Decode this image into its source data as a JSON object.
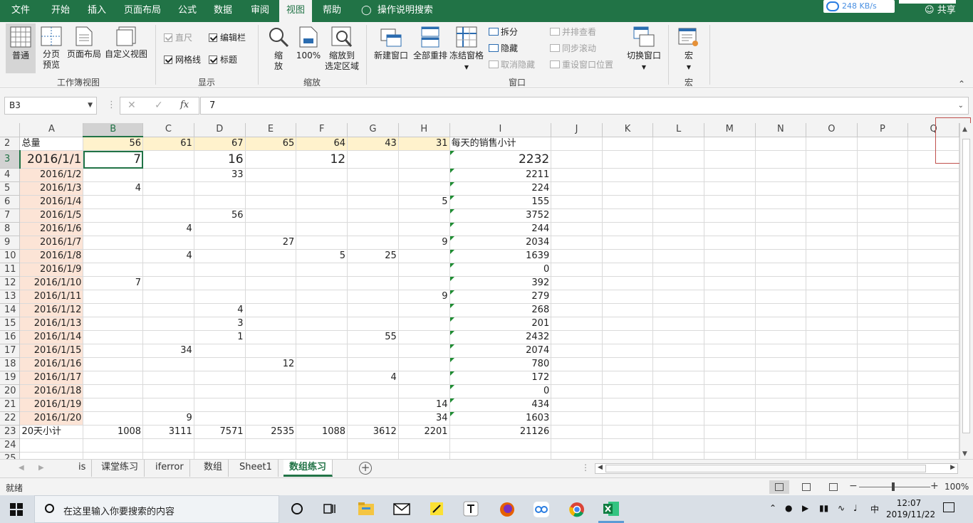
{
  "ribbon_tabs": [
    "文件",
    "开始",
    "插入",
    "页面布局",
    "公式",
    "数据",
    "审阅",
    "视图",
    "帮助",
    "操作说明搜索"
  ],
  "active_tab": "视图",
  "network_speed": "248 KB/s",
  "share_label": "共享",
  "ribbon": {
    "workbook_views": {
      "normal": "普通",
      "page_break_1": "分页",
      "page_break_2": "预览",
      "page_layout": "页面布局",
      "custom": "自定义视图",
      "group": "工作簿视图"
    },
    "show": {
      "ruler": "直尺",
      "formula_bar": "编辑栏",
      "gridlines": "网格线",
      "headings": "标题",
      "group": "显示"
    },
    "zoom": {
      "zoom_1": "缩",
      "zoom_2": "放",
      "hundred": "100%",
      "fit_1": "缩放到",
      "fit_2": "选定区域",
      "group": "缩放"
    },
    "window": {
      "new_window": "新建窗口",
      "arrange_all": "全部重排",
      "freeze": "冻结窗格",
      "split": "拆分",
      "hide": "隐藏",
      "unhide": "取消隐藏",
      "side_by_side": "并排查看",
      "sync_scroll": "同步滚动",
      "reset_pos": "重设窗口位置",
      "switch": "切换窗口",
      "group": "窗口"
    },
    "macros": {
      "macro": "宏",
      "group": "宏"
    }
  },
  "formula_bar": {
    "name_box": "B3",
    "fx": "fx",
    "value": "7"
  },
  "columns": [
    "A",
    "B",
    "C",
    "D",
    "E",
    "F",
    "G",
    "H",
    "I",
    "J",
    "K",
    "L",
    "M",
    "N",
    "O",
    "P",
    "Q"
  ],
  "rows": [
    {
      "n": "2",
      "a": "总量",
      "b": "56",
      "c": "61",
      "d": "67",
      "e": "65",
      "f": "64",
      "g": "43",
      "h": "31",
      "i": "每天的销售小计"
    },
    {
      "n": "3",
      "a": "2016/1/1",
      "b": "7",
      "c": "",
      "d": "16",
      "e": "",
      "f": "12",
      "g": "",
      "h": "",
      "i": "2232"
    },
    {
      "n": "4",
      "a": "2016/1/2",
      "b": "",
      "c": "",
      "d": "33",
      "e": "",
      "f": "",
      "g": "",
      "h": "",
      "i": "2211"
    },
    {
      "n": "5",
      "a": "2016/1/3",
      "b": "4",
      "c": "",
      "d": "",
      "e": "",
      "f": "",
      "g": "",
      "h": "",
      "i": "224"
    },
    {
      "n": "6",
      "a": "2016/1/4",
      "b": "",
      "c": "",
      "d": "",
      "e": "",
      "f": "",
      "g": "",
      "h": "5",
      "i": "155"
    },
    {
      "n": "7",
      "a": "2016/1/5",
      "b": "",
      "c": "",
      "d": "56",
      "e": "",
      "f": "",
      "g": "",
      "h": "",
      "i": "3752"
    },
    {
      "n": "8",
      "a": "2016/1/6",
      "b": "",
      "c": "4",
      "d": "",
      "e": "",
      "f": "",
      "g": "",
      "h": "",
      "i": "244"
    },
    {
      "n": "9",
      "a": "2016/1/7",
      "b": "",
      "c": "",
      "d": "",
      "e": "27",
      "f": "",
      "g": "",
      "h": "9",
      "i": "2034"
    },
    {
      "n": "10",
      "a": "2016/1/8",
      "b": "",
      "c": "4",
      "d": "",
      "e": "",
      "f": "5",
      "g": "25",
      "h": "",
      "i": "1639"
    },
    {
      "n": "11",
      "a": "2016/1/9",
      "b": "",
      "c": "",
      "d": "",
      "e": "",
      "f": "",
      "g": "",
      "h": "",
      "i": "0"
    },
    {
      "n": "12",
      "a": "2016/1/10",
      "b": "7",
      "c": "",
      "d": "",
      "e": "",
      "f": "",
      "g": "",
      "h": "",
      "i": "392"
    },
    {
      "n": "13",
      "a": "2016/1/11",
      "b": "",
      "c": "",
      "d": "",
      "e": "",
      "f": "",
      "g": "",
      "h": "9",
      "i": "279"
    },
    {
      "n": "14",
      "a": "2016/1/12",
      "b": "",
      "c": "",
      "d": "4",
      "e": "",
      "f": "",
      "g": "",
      "h": "",
      "i": "268"
    },
    {
      "n": "15",
      "a": "2016/1/13",
      "b": "",
      "c": "",
      "d": "3",
      "e": "",
      "f": "",
      "g": "",
      "h": "",
      "i": "201"
    },
    {
      "n": "16",
      "a": "2016/1/14",
      "b": "",
      "c": "",
      "d": "1",
      "e": "",
      "f": "",
      "g": "55",
      "h": "",
      "i": "2432"
    },
    {
      "n": "17",
      "a": "2016/1/15",
      "b": "",
      "c": "34",
      "d": "",
      "e": "",
      "f": "",
      "g": "",
      "h": "",
      "i": "2074"
    },
    {
      "n": "18",
      "a": "2016/1/16",
      "b": "",
      "c": "",
      "d": "",
      "e": "12",
      "f": "",
      "g": "",
      "h": "",
      "i": "780"
    },
    {
      "n": "19",
      "a": "2016/1/17",
      "b": "",
      "c": "",
      "d": "",
      "e": "",
      "f": "",
      "g": "4",
      "h": "",
      "i": "172"
    },
    {
      "n": "20",
      "a": "2016/1/18",
      "b": "",
      "c": "",
      "d": "",
      "e": "",
      "f": "",
      "g": "",
      "h": "",
      "i": "0"
    },
    {
      "n": "21",
      "a": "2016/1/19",
      "b": "",
      "c": "",
      "d": "",
      "e": "",
      "f": "",
      "g": "",
      "h": "14",
      "i": "434"
    },
    {
      "n": "22",
      "a": "2016/1/20",
      "b": "",
      "c": "9",
      "d": "",
      "e": "",
      "f": "",
      "g": "",
      "h": "34",
      "i": "1603"
    },
    {
      "n": "23",
      "a": "20天小计",
      "b": "1008",
      "c": "3111",
      "d": "7571",
      "e": "2535",
      "f": "1088",
      "g": "3612",
      "h": "2201",
      "i": "21126"
    },
    {
      "n": "24",
      "a": "",
      "b": "",
      "c": "",
      "d": "",
      "e": "",
      "f": "",
      "g": "",
      "h": "",
      "i": ""
    },
    {
      "n": "25",
      "a": "",
      "b": "",
      "c": "",
      "d": "",
      "e": "",
      "f": "",
      "g": "",
      "h": "",
      "i": ""
    }
  ],
  "sheet_tabs": [
    "is",
    "课堂练习",
    "iferror",
    "数组",
    "Sheet1",
    "数组练习"
  ],
  "active_sheet": "数组练习",
  "status": {
    "ready": "就绪",
    "zoom": "100%"
  },
  "taskbar": {
    "search_placeholder": "在这里输入你要搜索的内容",
    "time": "12:07",
    "date": "2019/11/22",
    "ime": "中"
  },
  "colors": {
    "excel_green": "#217346",
    "date_fill": "#fce4d6",
    "header_fill": "#fff2cc"
  }
}
